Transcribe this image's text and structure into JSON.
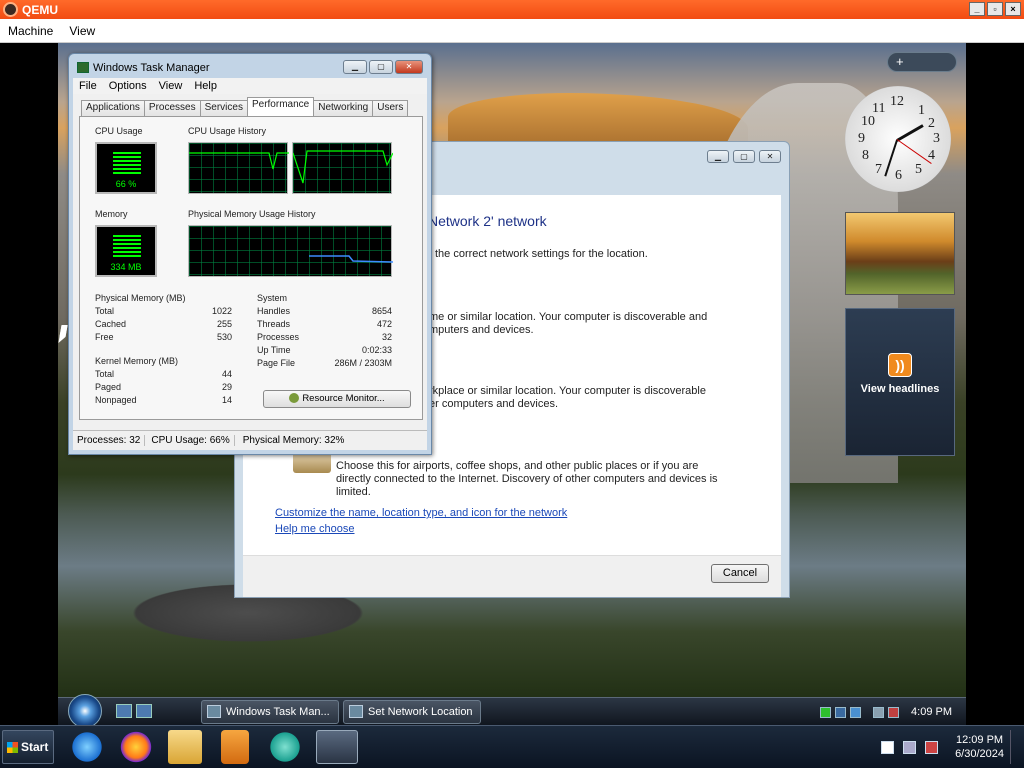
{
  "host": {
    "title": "QEMU",
    "menu": [
      "Machine",
      "View"
    ],
    "start_label": "Start",
    "apps": [
      "internet-explorer",
      "firefox",
      "file-explorer",
      "media-player",
      "messenger",
      "qemu"
    ],
    "clock_time": "12:09 PM",
    "clock_date": "6/30/2024"
  },
  "sidebar": {
    "control_label": "+",
    "clock_numbers": [
      "12",
      "1",
      "2",
      "3",
      "4",
      "5",
      "6",
      "7",
      "8",
      "9",
      "10",
      "11"
    ],
    "feed_label": "View headlines"
  },
  "network_window": {
    "heading": "Network  2' network",
    "lines": [
      "the correct network settings for the location.",
      "me or similar location. Your computer is discoverable and",
      "mputers and devices.",
      "rkplace or similar location. Your computer is discoverable",
      "er computers and devices.",
      "Choose this for airports, coffee shops, and other public places or if you are",
      "directly connected to the Internet. Discovery of other computers and devices is",
      "limited."
    ],
    "link_customize": "Customize the name, location type, and icon for the network",
    "link_help": "Help me choose",
    "cancel_label": "Cancel"
  },
  "task_manager": {
    "title": "Windows Task Manager",
    "menu": [
      "File",
      "Options",
      "View",
      "Help"
    ],
    "tabs": [
      "Applications",
      "Processes",
      "Services",
      "Performance",
      "Networking",
      "Users"
    ],
    "active_tab": "Performance",
    "cpu_label": "CPU Usage",
    "cpu_value": "66 %",
    "cpu_history_label": "CPU Usage History",
    "memory_label": "Memory",
    "memory_value": "334 MB",
    "mem_history_label": "Physical Memory Usage History",
    "physical_memory": {
      "header": "Physical Memory (MB)",
      "rows": [
        [
          "Total",
          "1022"
        ],
        [
          "Cached",
          "255"
        ],
        [
          "Free",
          "530"
        ]
      ]
    },
    "kernel_memory": {
      "header": "Kernel Memory (MB)",
      "rows": [
        [
          "Total",
          "44"
        ],
        [
          "Paged",
          "29"
        ],
        [
          "Nonpaged",
          "14"
        ]
      ]
    },
    "system": {
      "header": "System",
      "rows": [
        [
          "Handles",
          "8654"
        ],
        [
          "Threads",
          "472"
        ],
        [
          "Processes",
          "32"
        ],
        [
          "Up Time",
          "0:02:33"
        ],
        [
          "Page File",
          "286M / 2303M"
        ]
      ]
    },
    "resource_monitor_label": "Resource Monitor...",
    "status": {
      "processes": "Processes: 32",
      "cpu": "CPU Usage: 66%",
      "memory": "Physical Memory: 32%"
    }
  },
  "guest_taskbar": {
    "buttons": [
      "Windows Task Man...",
      "Set Network Location"
    ],
    "time": "4:09 PM"
  },
  "colors": {
    "qemu_title": "#f24c12",
    "graph_green": "#00ff00",
    "link_blue": "#1a48b8",
    "heading_blue": "#1e3287"
  }
}
